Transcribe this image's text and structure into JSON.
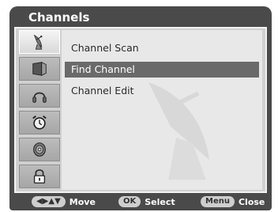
{
  "window": {
    "title": "Channels"
  },
  "sidebar": {
    "items": [
      {
        "icon": "satellite-dish-icon",
        "active": true
      },
      {
        "icon": "picture-icon",
        "active": false
      },
      {
        "icon": "headphones-icon",
        "active": false
      },
      {
        "icon": "alarm-clock-icon",
        "active": false
      },
      {
        "icon": "cd-disc-icon",
        "active": false
      },
      {
        "icon": "padlock-icon",
        "active": false
      }
    ]
  },
  "menu": {
    "items": [
      {
        "label": "Channel Scan",
        "selected": false
      },
      {
        "label": "Find Channel",
        "selected": true
      },
      {
        "label": "Channel Edit",
        "selected": false
      }
    ]
  },
  "footer": {
    "move_key": "◀▶▲▼",
    "move_label": "Move",
    "select_key": "OK",
    "select_label": "Select",
    "close_key": "Menu",
    "close_label": "Close"
  },
  "colors": {
    "frame": "#4a4a4a",
    "panel": "#d0d0d0",
    "content": "#e8e8e8",
    "highlight": "#6a6a6a",
    "text": "#2b2b2b"
  }
}
